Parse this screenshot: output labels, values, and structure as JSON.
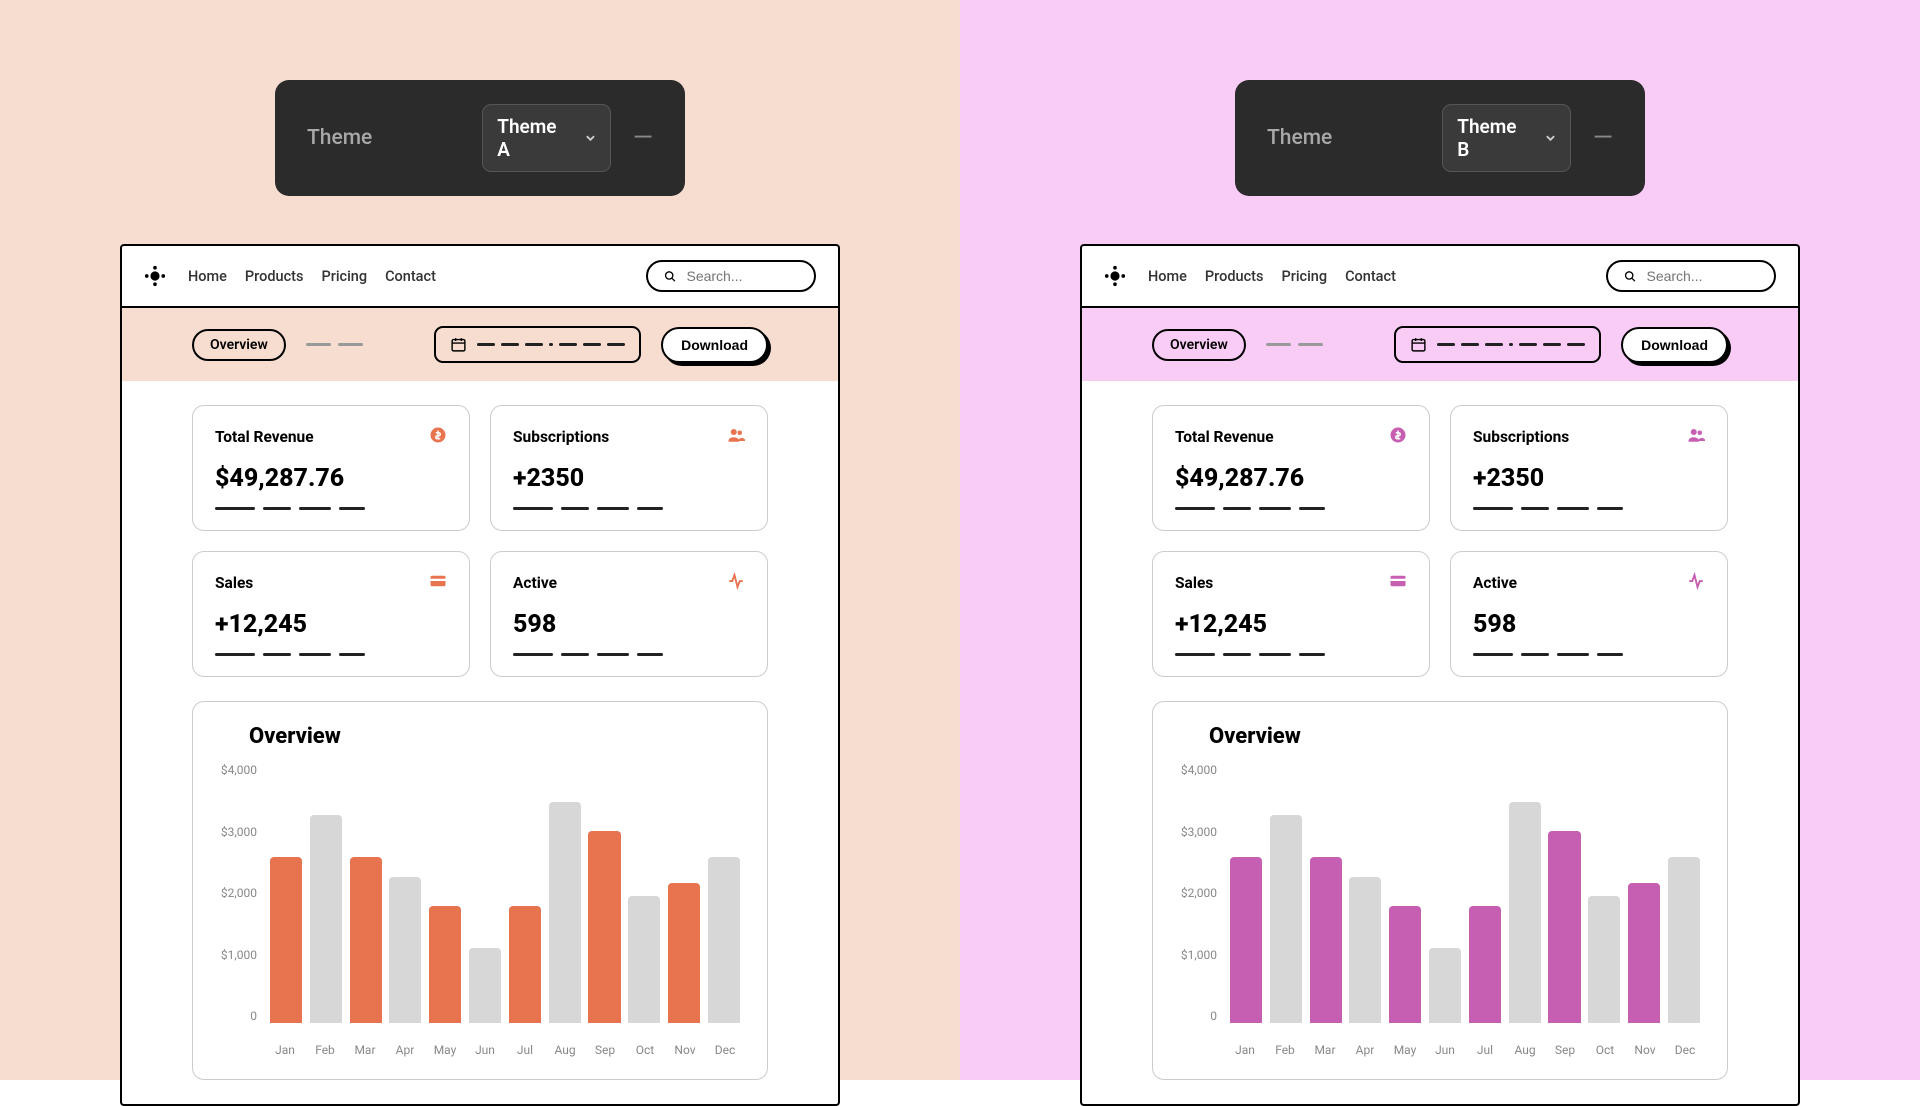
{
  "themes": [
    {
      "key": "a",
      "toolbar": {
        "label": "Theme",
        "value": "Theme A"
      }
    },
    {
      "key": "b",
      "toolbar": {
        "label": "Theme",
        "value": "Theme B"
      }
    }
  ],
  "nav": {
    "items": [
      "Home",
      "Products",
      "Pricing",
      "Contact"
    ]
  },
  "search": {
    "placeholder": "Search..."
  },
  "tabs": {
    "active": "Overview"
  },
  "download_label": "Download",
  "cards": [
    {
      "title": "Total Revenue",
      "value": "$49,287.76",
      "icon": "dollar-icon"
    },
    {
      "title": "Subscriptions",
      "value": "+2350",
      "icon": "users-icon"
    },
    {
      "title": "Sales",
      "value": "+12,245",
      "icon": "card-icon"
    },
    {
      "title": "Active",
      "value": "598",
      "icon": "activity-icon"
    }
  ],
  "chart_data": {
    "type": "bar",
    "title": "Overview",
    "xlabel": "",
    "ylabel": "",
    "ylim": [
      0,
      4000
    ],
    "yticks": [
      0,
      1000,
      2000,
      3000,
      4000
    ],
    "ytick_labels": [
      "0",
      "$1,000",
      "$2,000",
      "$3,000",
      "$4,000"
    ],
    "categories": [
      "Jan",
      "Feb",
      "Mar",
      "Apr",
      "May",
      "Jun",
      "Jul",
      "Aug",
      "Sep",
      "Oct",
      "Nov",
      "Dec"
    ],
    "values": [
      2550,
      3200,
      2550,
      2250,
      1800,
      1150,
      1800,
      3400,
      2950,
      1950,
      2150,
      2550
    ]
  },
  "colors": {
    "a_accent": "#e8744f",
    "b_accent": "#c65eb2",
    "bar_even": "#d7d7d7"
  }
}
